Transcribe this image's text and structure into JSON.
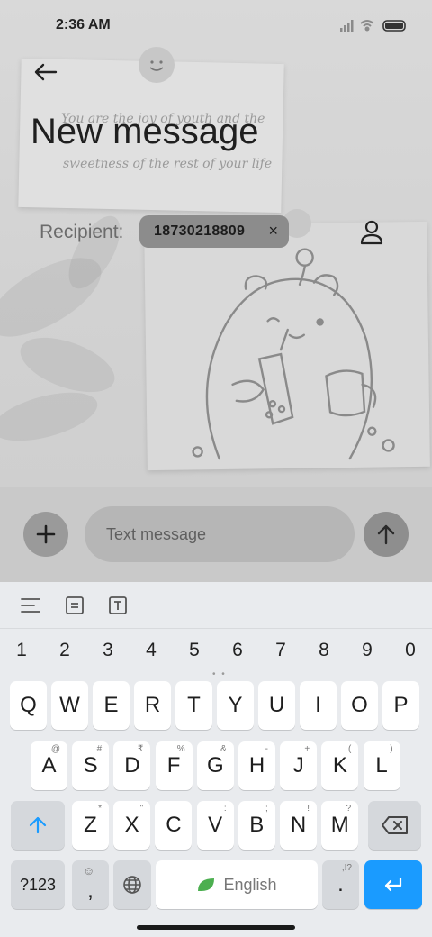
{
  "status_bar": {
    "time": "2:36 AM"
  },
  "header": {
    "title": "New message"
  },
  "wallpaper": {
    "quote_line1": "You are the joy of youth and the",
    "quote_line2": "sweetness of the rest of your life"
  },
  "recipient": {
    "label": "Recipient:",
    "chip_value": "18730218809",
    "chip_remove": "×"
  },
  "compose": {
    "placeholder": "Text message"
  },
  "keyboard": {
    "numbers": [
      "1",
      "2",
      "3",
      "4",
      "5",
      "6",
      "7",
      "8",
      "9",
      "0"
    ],
    "row1": [
      {
        "k": "Q",
        "s": ""
      },
      {
        "k": "W",
        "s": ""
      },
      {
        "k": "E",
        "s": ""
      },
      {
        "k": "R",
        "s": ""
      },
      {
        "k": "T",
        "s": ""
      },
      {
        "k": "Y",
        "s": ""
      },
      {
        "k": "U",
        "s": ""
      },
      {
        "k": "I",
        "s": ""
      },
      {
        "k": "O",
        "s": ""
      },
      {
        "k": "P",
        "s": ""
      }
    ],
    "row2": [
      {
        "k": "A",
        "s": "@"
      },
      {
        "k": "S",
        "s": "#"
      },
      {
        "k": "D",
        "s": "₹"
      },
      {
        "k": "F",
        "s": "%"
      },
      {
        "k": "G",
        "s": "&"
      },
      {
        "k": "H",
        "s": "-"
      },
      {
        "k": "J",
        "s": "+"
      },
      {
        "k": "K",
        "s": "("
      },
      {
        "k": "L",
        "s": ")"
      }
    ],
    "row3": [
      {
        "k": "Z",
        "s": "*"
      },
      {
        "k": "X",
        "s": "\""
      },
      {
        "k": "C",
        "s": "'"
      },
      {
        "k": "V",
        "s": ":"
      },
      {
        "k": "B",
        "s": ";"
      },
      {
        "k": "N",
        "s": "!"
      },
      {
        "k": "M",
        "s": "?"
      }
    ],
    "symbols_key": "?123",
    "comma_key": ",",
    "space_label": "English",
    "period_key": ".",
    "period_sub": ",!?"
  },
  "colors": {
    "accent": "#1a9bff",
    "leaf": "#4caf50"
  },
  "icons": {
    "back": "arrow-left-icon",
    "contact": "person-icon",
    "add": "plus-icon",
    "send": "arrow-up-icon",
    "shift": "shift-icon",
    "backspace": "backspace-icon",
    "globe": "globe-icon",
    "enter": "enter-icon",
    "emoji": "emoji-icon"
  }
}
